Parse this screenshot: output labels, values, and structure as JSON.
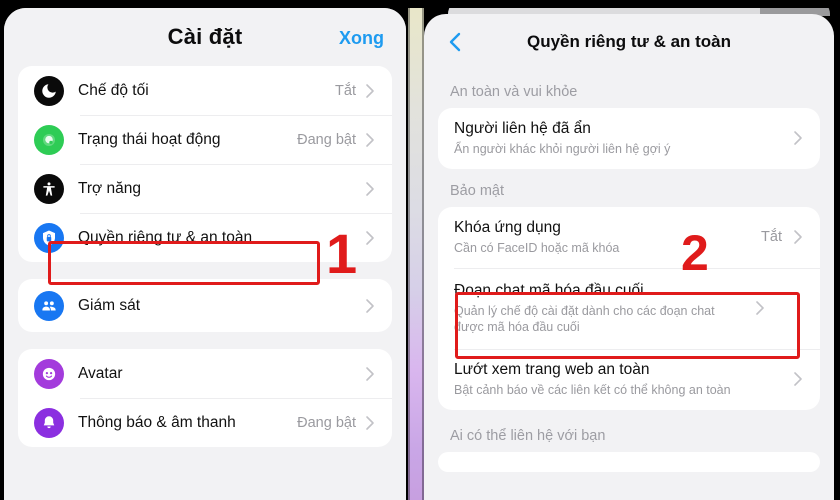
{
  "colors": {
    "accent_blue": "#1e9bf0",
    "highlight_red": "#e01b1b",
    "panel_bg": "#f2f2f4",
    "card_bg": "#ffffff",
    "muted_text": "#9a9a9f"
  },
  "left_panel": {
    "title": "Cài đặt",
    "done_label": "Xong",
    "groups": [
      {
        "rows": [
          {
            "icon": "moon-icon",
            "icon_color": "#0a0a0a",
            "label": "Chế độ tối",
            "value": "Tắt"
          },
          {
            "icon": "active-status-icon",
            "icon_color": "#2ecc55",
            "label": "Trạng thái hoạt động",
            "value": "Đang bật"
          },
          {
            "icon": "accessibility-icon",
            "icon_color": "#0a0a0a",
            "label": "Trợ năng",
            "value": ""
          },
          {
            "icon": "lock-shield-icon",
            "icon_color": "#1877f2",
            "label": "Quyền riêng tư & an toàn",
            "value": ""
          }
        ]
      },
      {
        "rows": [
          {
            "icon": "supervision-people-icon",
            "icon_color": "#1877f2",
            "label": "Giám sát",
            "value": ""
          }
        ]
      },
      {
        "rows": [
          {
            "icon": "avatar-face-icon",
            "icon_color": "#a33bdc",
            "label": "Avatar",
            "value": ""
          },
          {
            "icon": "bell-icon",
            "icon_color": "#8b2fe0",
            "label": "Thông báo & âm thanh",
            "value": "Đang bật"
          }
        ]
      }
    ]
  },
  "right_panel": {
    "back_icon": "chevron-left-icon",
    "title": "Quyền riêng tư & an toàn",
    "sections": [
      {
        "heading": "An toàn và vui khỏe",
        "rows": [
          {
            "title": "Người liên hệ đã ẩn",
            "subtitle": "Ẩn người khác khỏi người liên hệ gợi ý",
            "value": ""
          }
        ]
      },
      {
        "heading": "Bảo mật",
        "rows": [
          {
            "title": "Khóa ứng dụng",
            "subtitle": "Cần có FaceID hoặc mã khóa",
            "value": "Tắt"
          },
          {
            "title": "Đoạn chat mã hóa đầu cuối",
            "subtitle": "Quản lý chế độ cài đặt dành cho các đoạn chat được mã hóa đầu cuối",
            "value": ""
          },
          {
            "title": "Lướt xem trang web an toàn",
            "subtitle": "Bật cảnh báo về các liên kết có thể không an toàn",
            "value": ""
          }
        ]
      },
      {
        "heading": "Ai có thể liên hệ với bạn",
        "rows": []
      }
    ]
  },
  "annotations": {
    "step_one": "1",
    "step_two": "2"
  }
}
